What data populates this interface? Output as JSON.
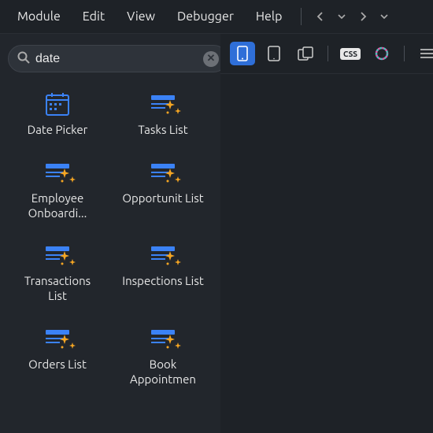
{
  "menu": {
    "module": "Module",
    "edit": "Edit",
    "view": "View",
    "debugger": "Debugger",
    "help": "Help"
  },
  "search": {
    "value": "date"
  },
  "grid_items": [
    {
      "label": "Date Picker",
      "icon": "calendar"
    },
    {
      "label": "Tasks List",
      "icon": "list-sparkle"
    },
    {
      "label": "Employee Onboardi...",
      "icon": "list-sparkle"
    },
    {
      "label": "Opportunit List",
      "icon": "list-sparkle"
    },
    {
      "label": "Transactions List",
      "icon": "list-sparkle"
    },
    {
      "label": "Inspections List",
      "icon": "list-sparkle"
    },
    {
      "label": "Orders List",
      "icon": "list-sparkle"
    },
    {
      "label": "Book Appointmen",
      "icon": "list-sparkle"
    }
  ]
}
